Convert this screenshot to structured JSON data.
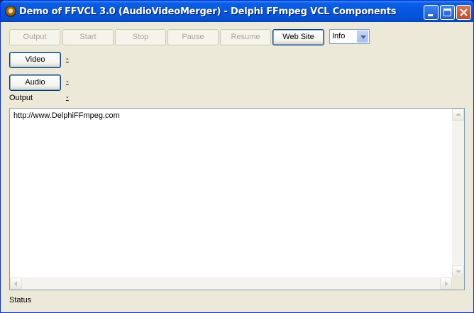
{
  "window": {
    "title": "Demo of FFVCL 3.0 (AudioVideoMerger) - Delphi FFmpeg VCL Components",
    "app_icon": "ffvcl-app-icon"
  },
  "titlebar_buttons": {
    "minimize": "minimize-icon",
    "maximize": "maximize-icon",
    "close": "close-icon"
  },
  "toolbar": {
    "output_label": "Output",
    "start_label": "Start",
    "stop_label": "Stop",
    "pause_label": "Pause",
    "resume_label": "Resume",
    "website_label": "Web Site",
    "loglevel_value": "Info"
  },
  "inputs": {
    "video_label": "Video",
    "video_path": "-",
    "audio_label": "Audio",
    "audio_path": "-",
    "output_caption": "Output",
    "output_path": "-"
  },
  "log": {
    "text": "http://www.DelphiFFmpeg.com"
  },
  "status": {
    "text": "Status"
  },
  "colors": {
    "titlebar": "#0556e2",
    "window_bg": "#ece9d8",
    "button_border": "#003c74",
    "disabled_text": "#aca899"
  }
}
